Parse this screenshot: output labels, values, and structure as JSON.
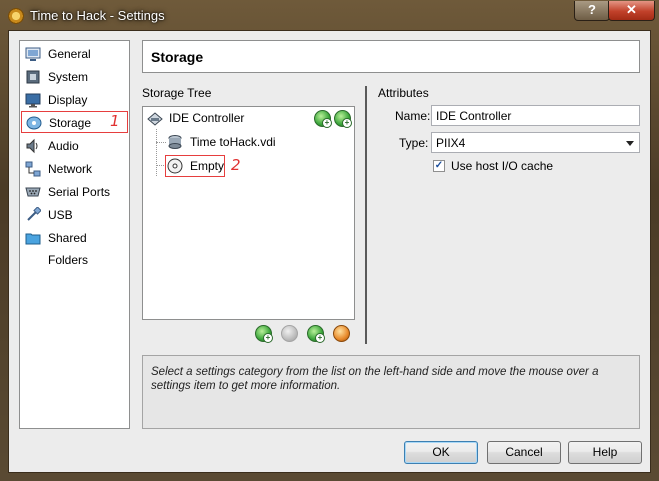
{
  "window": {
    "title": "Time to Hack - Settings",
    "help_glyph": "?",
    "close_glyph": "✕"
  },
  "categories": [
    {
      "label": "General",
      "icon": "general-icon"
    },
    {
      "label": "System",
      "icon": "system-icon"
    },
    {
      "label": "Display",
      "icon": "display-icon"
    },
    {
      "label": "Storage",
      "icon": "storage-icon",
      "selected": true
    },
    {
      "label": "Audio",
      "icon": "audio-icon"
    },
    {
      "label": "Network",
      "icon": "network-icon"
    },
    {
      "label": "Serial Ports",
      "icon": "serial-ports-icon"
    },
    {
      "label": "USB",
      "icon": "usb-icon"
    },
    {
      "label": "Shared Folders",
      "icon": "shared-folders-icon"
    }
  ],
  "annotations": {
    "one": "1",
    "two": "2"
  },
  "page_header": {
    "title": "Storage"
  },
  "storage_tree": {
    "label": "Storage Tree",
    "controller": "IDE Controller",
    "items": [
      "Time toHack.vdi",
      "Empty"
    ]
  },
  "attributes": {
    "label": "Attributes",
    "name_label": "Name:",
    "name_value": "IDE Controller",
    "type_label": "Type:",
    "type_value": "PIIX4",
    "cache_label": "Use host I/O cache",
    "cache_checked": true
  },
  "info": {
    "text": "Select a settings category from the list on the left-hand side and move the mouse over a settings item to get more information."
  },
  "buttons": {
    "ok": "OK",
    "cancel": "Cancel",
    "help": "Help"
  }
}
